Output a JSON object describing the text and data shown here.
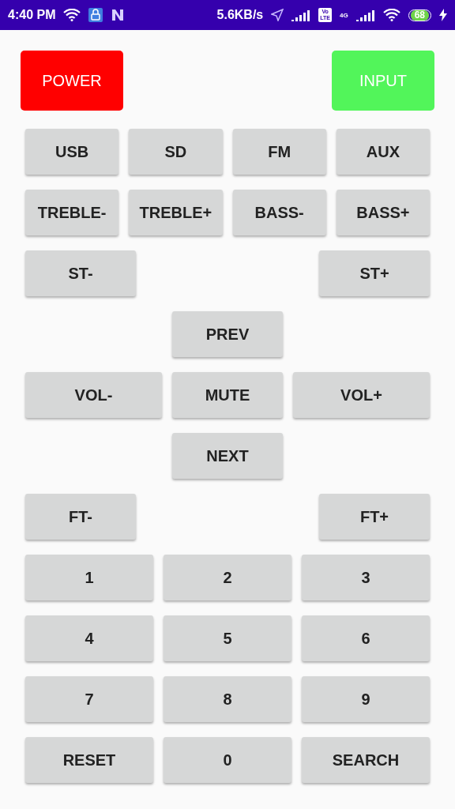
{
  "status_bar": {
    "time": "4:40 PM",
    "speed": "5.6KB/s",
    "volte_top": "Vo",
    "volte_bottom": "LTE",
    "network": "4G",
    "battery": "68"
  },
  "top_buttons": [
    {
      "label": "POWER",
      "color": "#ff0000"
    },
    {
      "label": "INPUT",
      "color": "#52f55a"
    }
  ],
  "rows": [
    {
      "kind": "grid4",
      "buttons": [
        "USB",
        "SD",
        "FM",
        "AUX"
      ]
    },
    {
      "kind": "grid4",
      "buttons": [
        "TREBLE-",
        "TREBLE+",
        "BASS-",
        "BASS+"
      ]
    },
    {
      "kind": "split",
      "buttons": [
        "ST-",
        "ST+"
      ]
    },
    {
      "kind": "center",
      "buttons": [
        "PREV"
      ]
    },
    {
      "kind": "trio",
      "buttons": [
        "VOL-",
        "MUTE",
        "VOL+"
      ]
    },
    {
      "kind": "center",
      "buttons": [
        "NEXT"
      ]
    },
    {
      "kind": "split",
      "buttons": [
        "FT-",
        "FT+"
      ]
    },
    {
      "kind": "grid3",
      "buttons": [
        "1",
        "2",
        "3"
      ]
    },
    {
      "kind": "grid3",
      "buttons": [
        "4",
        "5",
        "6"
      ]
    },
    {
      "kind": "grid3",
      "buttons": [
        "7",
        "8",
        "9"
      ]
    },
    {
      "kind": "grid3",
      "buttons": [
        "RESET",
        "0",
        "SEARCH"
      ]
    }
  ]
}
